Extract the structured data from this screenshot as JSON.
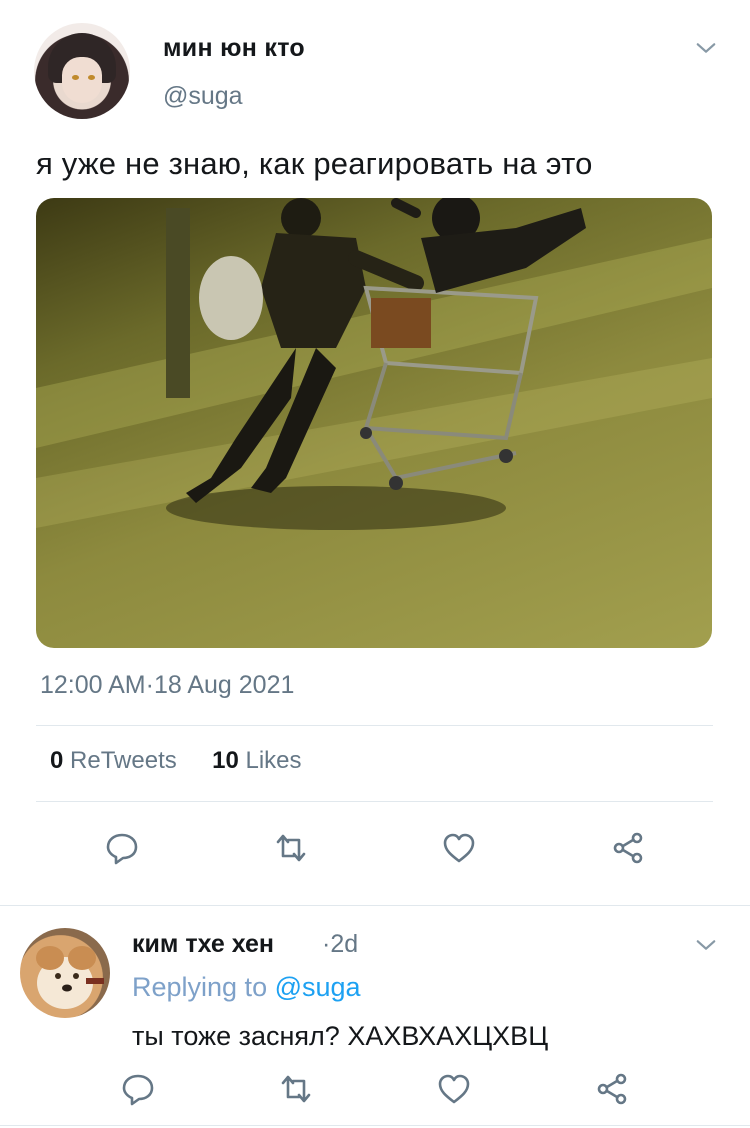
{
  "tweet": {
    "display_name": "мин юн кто",
    "handle": "@suga",
    "text": "я уже не знаю, как реагировать на это",
    "timestamp": "12:00 AM·18 Aug 2021",
    "retweets_count": "0",
    "retweets_label": "ReTweets",
    "likes_count": "10",
    "likes_label": "Likes",
    "media_description": "photo"
  },
  "reply": {
    "display_name": "ким тхе хен",
    "time": "·2d",
    "replying_prefix": "Replying to",
    "replying_handle": "@suga",
    "text": "ты тоже заснял? ХАХВХАХЦХВЦ"
  },
  "icons": {
    "reply": "reply-icon",
    "retweet": "retweet-icon",
    "like": "heart-icon",
    "share": "share-icon",
    "more": "chevron-down-icon"
  },
  "colors": {
    "text": "#14171a",
    "secondary": "#657786",
    "link": "#1da1f2",
    "divider": "#e1e8ed"
  }
}
